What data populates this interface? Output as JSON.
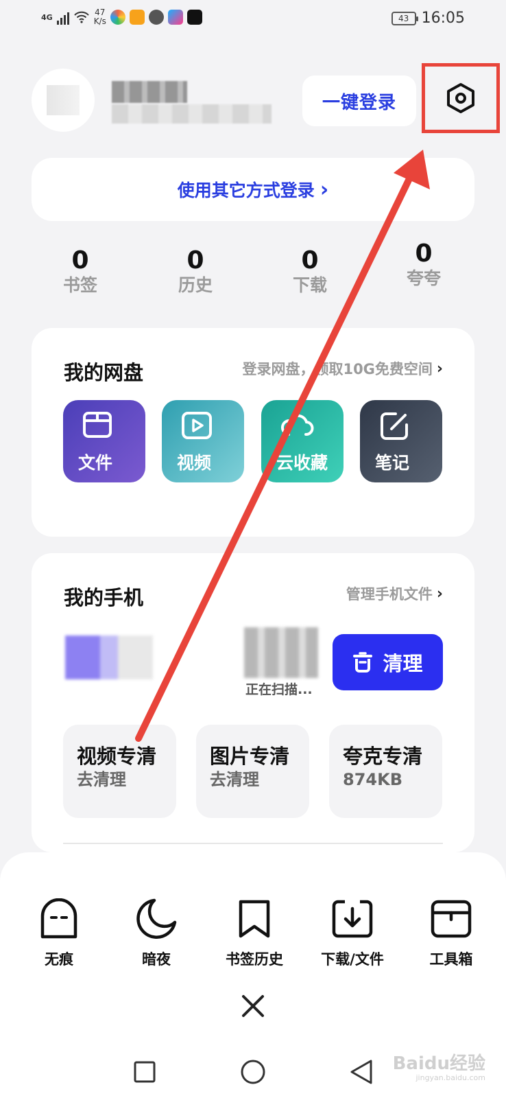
{
  "status_bar": {
    "network": "4G",
    "net_speed_value": "47",
    "net_speed_unit": "K/s",
    "battery": "43",
    "time": "16:05",
    "app_icons": [
      "app-icon-1",
      "app-icon-2",
      "app-icon-3",
      "app-icon-4",
      "tiktok-icon"
    ]
  },
  "header": {
    "login_button": "一键登录",
    "settings_icon": "hexagon-gear-icon"
  },
  "other_login": {
    "label": "使用其它方式登录",
    "chevron": "›"
  },
  "stats": [
    {
      "count": "0",
      "label": "书签"
    },
    {
      "count": "0",
      "label": "历史"
    },
    {
      "count": "0",
      "label": "下载"
    },
    {
      "count": "0",
      "label": "夸夸"
    }
  ],
  "cloud_drive": {
    "title": "我的网盘",
    "link": "登录网盘，领取10G免费空间",
    "chevron": "›",
    "tiles": [
      {
        "label": "文件",
        "icon": "folder-icon",
        "color_a": "#4b3fb8",
        "color_b": "#7b5ad0"
      },
      {
        "label": "视频",
        "icon": "play-icon",
        "color_a": "#2f9fb0",
        "color_b": "#7fd0d8"
      },
      {
        "label": "云收藏",
        "icon": "cloud-icon",
        "color_a": "#1aa394",
        "color_b": "#3fd0b8"
      },
      {
        "label": "笔记",
        "icon": "edit-icon",
        "color_a": "#2f3848",
        "color_b": "#566070"
      }
    ]
  },
  "my_phone": {
    "title": "我的手机",
    "link": "管理手机文件",
    "chevron": "›",
    "scanning": "正在扫描...",
    "clean_button": "清理",
    "tiles": [
      {
        "title": "视频专清",
        "value": "去清理"
      },
      {
        "title": "图片专清",
        "value": "去清理"
      },
      {
        "title": "夸克专清",
        "value": "874KB"
      }
    ]
  },
  "bottom_menu": {
    "items": [
      {
        "label": "无痕",
        "icon": "incognito-ghost-icon"
      },
      {
        "label": "暗夜",
        "icon": "moon-icon"
      },
      {
        "label": "书签历史",
        "icon": "bookmark-icon"
      },
      {
        "label": "下载/文件",
        "icon": "download-icon"
      },
      {
        "label": "工具箱",
        "icon": "toolbox-icon"
      }
    ],
    "close_icon": "close-icon"
  },
  "navbar": {
    "icons": [
      "square-recent-icon",
      "circle-home-icon",
      "triangle-back-icon"
    ]
  },
  "watermark": {
    "text": "Baidu经验",
    "sub": "jingyan.baidu.com"
  },
  "colors": {
    "accent_blue": "#2a3ee0",
    "clean_button": "#2b2ff0",
    "annotation_red": "#e8443a",
    "background": "#f3f3f5"
  }
}
